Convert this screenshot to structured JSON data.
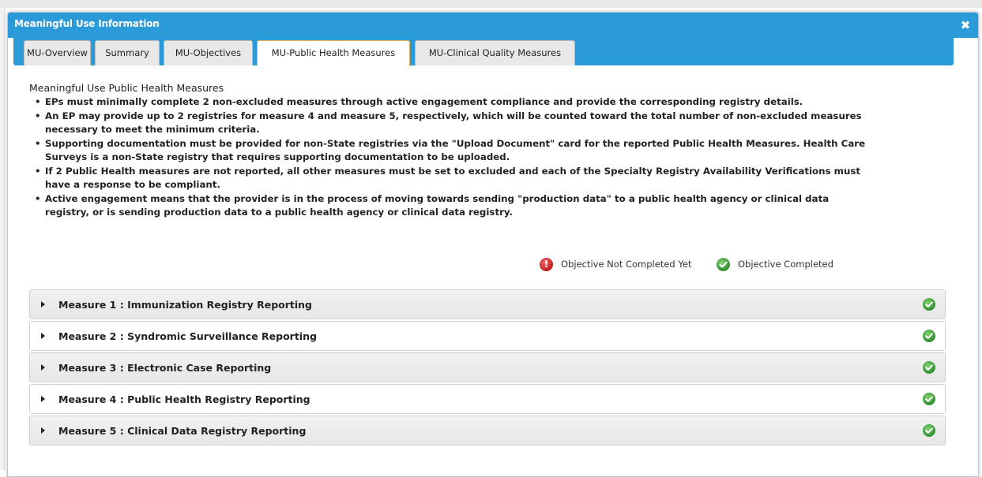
{
  "dialog": {
    "title": "Meaningful Use Information",
    "close_glyph": "✖"
  },
  "tabs": [
    {
      "label": "MU-Overview",
      "active": false
    },
    {
      "label": "Summary",
      "active": false
    },
    {
      "label": "MU-Objectives",
      "active": false
    },
    {
      "label": "MU-Public Health Measures",
      "active": true
    },
    {
      "label": "MU-Clinical Quality Measures",
      "active": false
    }
  ],
  "content": {
    "heading": "Meaningful Use Public Health Measures",
    "bullets": [
      [
        "EPs must minimally complete 2 non-excluded measures through active engagement compliance and provide the corresponding registry details."
      ],
      [
        "An EP may provide up to 2 registries for measure 4 and measure 5, respectively, which will be counted toward the total number of non-excluded measures",
        "necessary to meet the minimum criteria."
      ],
      [
        "Supporting documentation must be provided for non-State registries via the \"Upload Document\" card for the reported Public Health Measures. Health Care",
        "Surveys is a non-State registry that requires supporting documentation to be uploaded."
      ],
      [
        "If 2 Public Health measures are not reported, all other measures must be set to excluded and each of the Specialty Registry Availability Verifications must",
        "have a response to be compliant."
      ],
      [
        "Active engagement means that the provider is in the process of moving towards sending \"production data\" to a public health agency or clinical data",
        "registry, or is sending production data to a public health agency or clinical data registry."
      ]
    ]
  },
  "legend": {
    "not_completed": {
      "label": "Objective Not Completed Yet",
      "icon": "error-icon",
      "color": "#d32323"
    },
    "completed": {
      "label": "Objective Completed",
      "icon": "check-circle-icon",
      "color": "#3a9b35"
    }
  },
  "measures": [
    {
      "title": "Measure 1 : Immunization Registry Reporting",
      "status": "completed"
    },
    {
      "title": "Measure 2 : Syndromic Surveillance Reporting",
      "status": "completed"
    },
    {
      "title": "Measure 3 : Electronic Case Reporting",
      "status": "completed"
    },
    {
      "title": "Measure 4 : Public Health Registry Reporting",
      "status": "completed"
    },
    {
      "title": "Measure 5 : Clinical Data Registry Reporting",
      "status": "completed"
    }
  ],
  "colors": {
    "header_blue": "#2a9bd8",
    "active_tab_border": "#e2b15a"
  }
}
